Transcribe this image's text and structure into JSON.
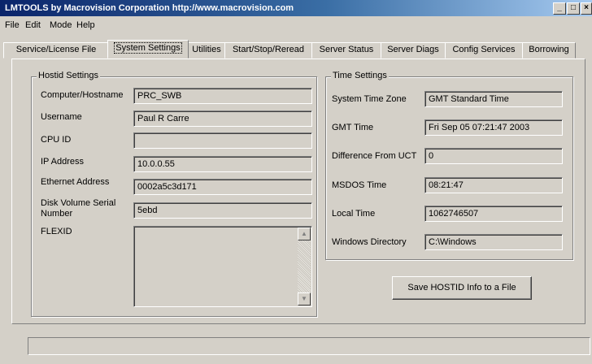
{
  "window": {
    "title": "LMTOOLS by Macrovision Corporation http://www.macrovision.com",
    "controls": {
      "minimize": "_",
      "maximize": "□",
      "close": "×"
    }
  },
  "menu": [
    "File",
    "Edit",
    "Mode",
    "Help"
  ],
  "tabs": [
    "Service/License File",
    "System Settings",
    "Utilities",
    "Start/Stop/Reread",
    "Server Status",
    "Server Diags",
    "Config Services",
    "Borrowing"
  ],
  "active_tab": "System Settings",
  "hostid": {
    "title": "Hostid Settings",
    "computer_label": "Computer/Hostname",
    "computer_value": "PRC_SWB",
    "username_label": "Username",
    "username_value": "Paul R Carre",
    "cpuid_label": "CPU ID",
    "cpuid_value": "",
    "ip_label": "IP Address",
    "ip_value": "10.0.0.55",
    "ethernet_label": "Ethernet Address",
    "ethernet_value": "0002a5c3d171",
    "disk_label_line1": "Disk Volume Serial",
    "disk_label_line2": "Number",
    "disk_value": "5ebd",
    "flexid_label": "FLEXID"
  },
  "time": {
    "title": "Time Settings",
    "tz_label": "System Time Zone",
    "tz_value": "GMT Standard Time",
    "gmt_label": "GMT Time",
    "gmt_value": "Fri Sep 05 07:21:47 2003",
    "diff_label": "Difference From UCT",
    "diff_value": "0",
    "msdos_label": "MSDOS Time",
    "msdos_value": "08:21:47",
    "local_label": "Local Time",
    "local_value": "1062746507",
    "windir_label": "Windows Directory",
    "windir_value": "C:\\Windows"
  },
  "save_button": "Save HOSTID Info to a File",
  "status_text": ""
}
